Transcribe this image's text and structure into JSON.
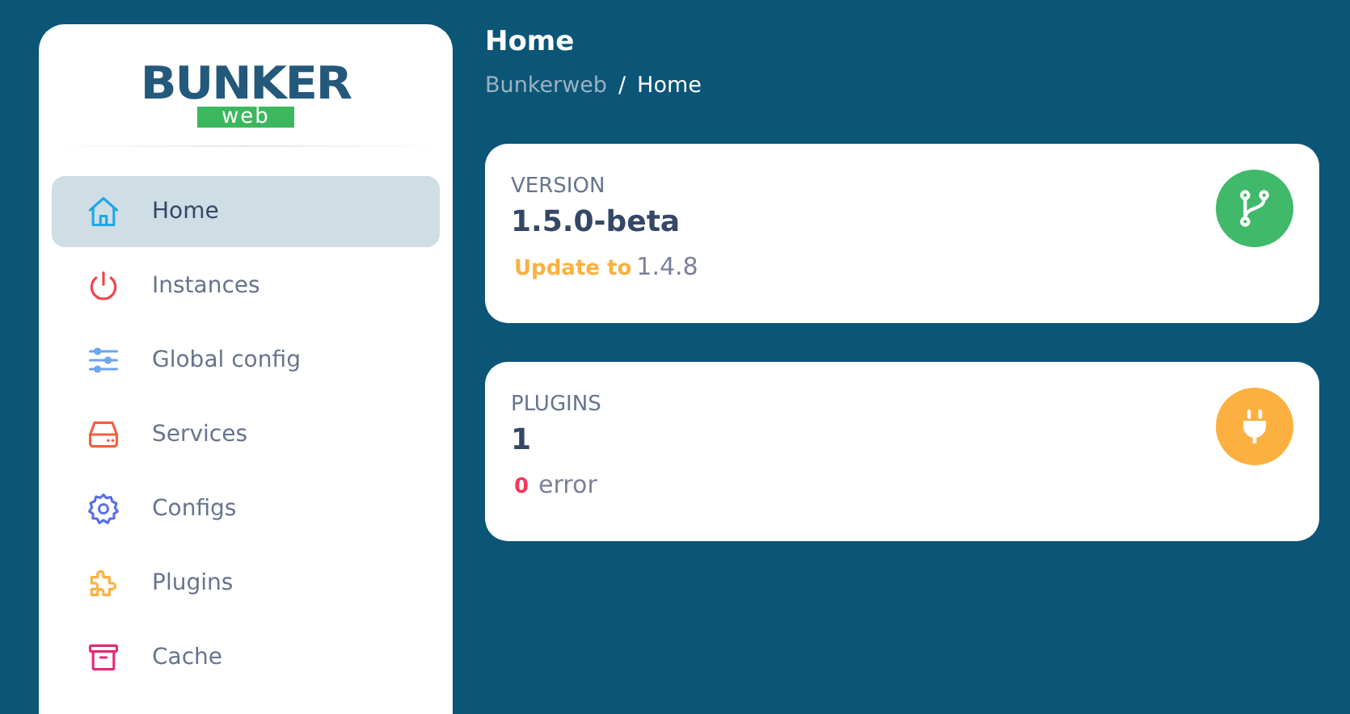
{
  "logo": {
    "title": "BUNKER",
    "subtitle": "web"
  },
  "sidebar": {
    "items": [
      {
        "label": "Home",
        "selected": true,
        "color": "#1ea7e8"
      },
      {
        "label": "Instances",
        "selected": false,
        "color": "#f0434a"
      },
      {
        "label": "Global config",
        "selected": false,
        "color": "#6aa5ef"
      },
      {
        "label": "Services",
        "selected": false,
        "color": "#f2603e"
      },
      {
        "label": "Configs",
        "selected": false,
        "color": "#5b6ee6"
      },
      {
        "label": "Plugins",
        "selected": false,
        "color": "#fcb040"
      },
      {
        "label": "Cache",
        "selected": false,
        "color": "#e22a76"
      }
    ]
  },
  "header": {
    "title": "Home",
    "separator": "/",
    "breadcrumb": [
      {
        "label": "Bunkerweb",
        "selected": false
      },
      {
        "label": "Home",
        "selected": true
      }
    ]
  },
  "cards": [
    {
      "kind": "version",
      "label": "VERSION",
      "value": "1.5.0-beta",
      "note_strong": "Update to",
      "note": "1.4.8",
      "color": "#40b96a"
    },
    {
      "kind": "plugins",
      "label": "PLUGINS",
      "value": "1",
      "note_strong": "0",
      "note": "error",
      "color": "#fbb040"
    }
  ]
}
